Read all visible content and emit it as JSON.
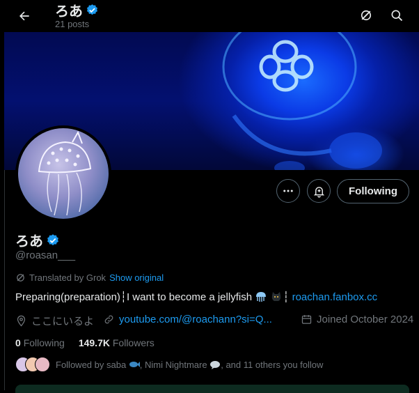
{
  "header": {
    "title": "ろあ",
    "posts_count": "21 posts"
  },
  "profile": {
    "name": "ろあ",
    "handle": "@roasan___",
    "translated_label": "Translated by Grok",
    "show_original": "Show original",
    "bio_text": "Preparing(preparation)┆I want to become a jellyfish",
    "bio_separator": "┆",
    "bio_link": "roachan.fanbox.cc",
    "location": "ここにいるよ",
    "website": "youtube.com/@roachann?si=Q...",
    "joined": "Joined October 2024"
  },
  "actions": {
    "follow_label": "Following"
  },
  "stats": {
    "following_count": "0",
    "following_label": "Following",
    "followers_count": "149.7K",
    "followers_label": "Followers"
  },
  "followed_by": {
    "text": "Followed by saba",
    "name2": ", Nimi Nightmare",
    "tail": ", and 11 others you follow"
  },
  "colors": {
    "accent": "#1d9bf0",
    "verified": "#1d9bf0",
    "muted": "#71767b",
    "text": "#e7e9ea",
    "background": "#000000"
  },
  "icons": [
    "back-arrow-icon",
    "grok-translate-icon",
    "search-icon",
    "verified-badge-icon",
    "more-icon",
    "notification-bell-icon",
    "location-icon",
    "link-icon",
    "calendar-icon",
    "jellyfish-emoji",
    "black-cat-emoji",
    "fish-emoji",
    "speech-bubble-emoji"
  ]
}
